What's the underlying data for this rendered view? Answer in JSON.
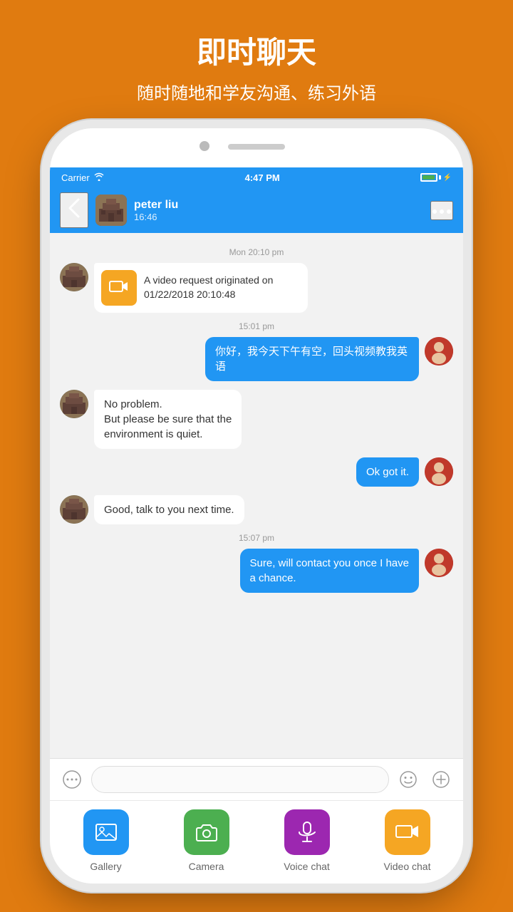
{
  "page": {
    "background_color": "#E07B10"
  },
  "header": {
    "title": "即时聊天",
    "subtitle": "随时随地和学友沟通、练习外语"
  },
  "status_bar": {
    "carrier": "Carrier",
    "time": "4:47 PM"
  },
  "chat_header": {
    "back_label": "‹",
    "contact_name": "peter liu",
    "contact_status": "16:46",
    "more_label": "···"
  },
  "messages": {
    "timestamp1": "Mon 20:10 pm",
    "video_request_text": "A video request originated on 01/22/2018 20:10:48",
    "timestamp2": "15:01 pm",
    "msg1": "你好，我今天下午有空，回头视频教我英语",
    "msg2_line1": "No  problem.",
    "msg2_line2": "But  please be sure that the",
    "msg2_line3": "environment is  quiet.",
    "msg3": "Ok got it.",
    "msg4": "Good, talk  to you next time.",
    "timestamp3": "15:07 pm",
    "msg5_line1": "Sure, will contact you once I have",
    "msg5_line2": "a chance."
  },
  "input": {
    "placeholder": ""
  },
  "toolbar": {
    "items": [
      {
        "id": "gallery",
        "label": "Gallery",
        "color": "#2196F3"
      },
      {
        "id": "camera",
        "label": "Camera",
        "color": "#4CAF50"
      },
      {
        "id": "voice",
        "label": "Voice chat",
        "color": "#9C27B0"
      },
      {
        "id": "video",
        "label": "Video chat",
        "color": "#F5A623"
      }
    ]
  }
}
